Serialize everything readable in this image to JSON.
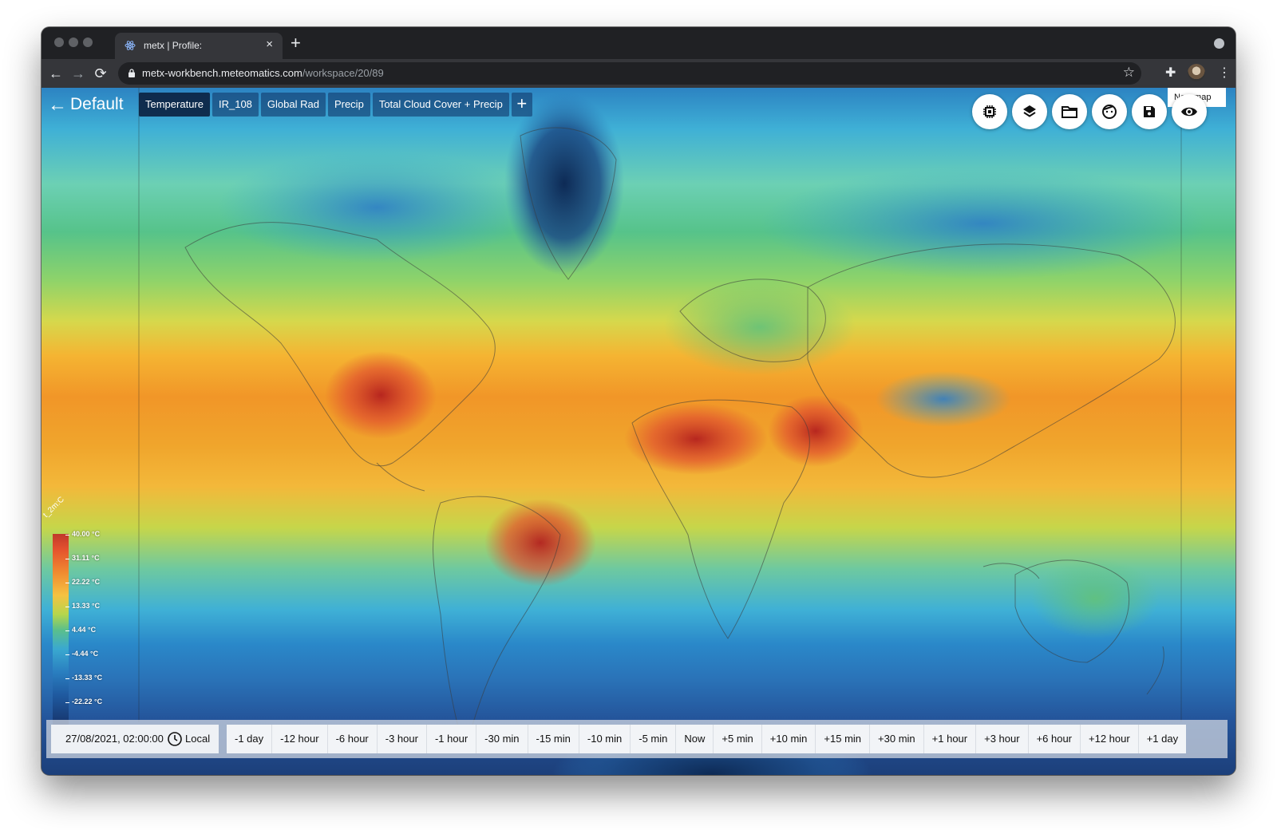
{
  "browser": {
    "tab_title": "metx | Profile:",
    "tab_close": "×",
    "new_tab": "+",
    "url_host": "metx-workbench.meteomatics.com",
    "url_path": "/workspace/20/89",
    "back": "←",
    "forward": "→",
    "reload": "⟳",
    "star": "☆",
    "extensions": "✚",
    "menu": "⋮"
  },
  "app": {
    "back_arrow": "←",
    "workspace_title": "Default",
    "layer_tabs": [
      "Temperature",
      "IR_108",
      "Global Rad",
      "Precip",
      "Total Cloud Cover + Precip"
    ],
    "active_layer": "Temperature",
    "add_layer": "+",
    "tooltip": "New map",
    "tools": [
      "processor-icon",
      "layers-icon",
      "folder-icon",
      "face-icon",
      "save-icon",
      "eye-icon"
    ]
  },
  "legend": {
    "title": "t_2m:C",
    "labels": [
      "40.00 °C",
      "31.11 °C",
      "22.22 °C",
      "13.33 °C",
      "4.44 °C",
      "-4.44 °C",
      "-13.33 °C",
      "-22.22 °C"
    ]
  },
  "timebar": {
    "datetime": "27/08/2021, 02:00:00",
    "timezone": "Local",
    "steps": [
      "-1 day",
      "-12 hour",
      "-6 hour",
      "-3 hour",
      "-1 hour",
      "-30 min",
      "-15 min",
      "-10 min",
      "-5 min",
      "Now",
      "+5 min",
      "+10 min",
      "+15 min",
      "+30 min",
      "+1 hour",
      "+3 hour",
      "+6 hour",
      "+12 hour",
      "+1 day"
    ]
  },
  "colors": {
    "hot": "#c0392b",
    "warm": "#f19628",
    "mild": "#56c38a",
    "cold": "#2a88c9",
    "frozen": "#16346b"
  }
}
